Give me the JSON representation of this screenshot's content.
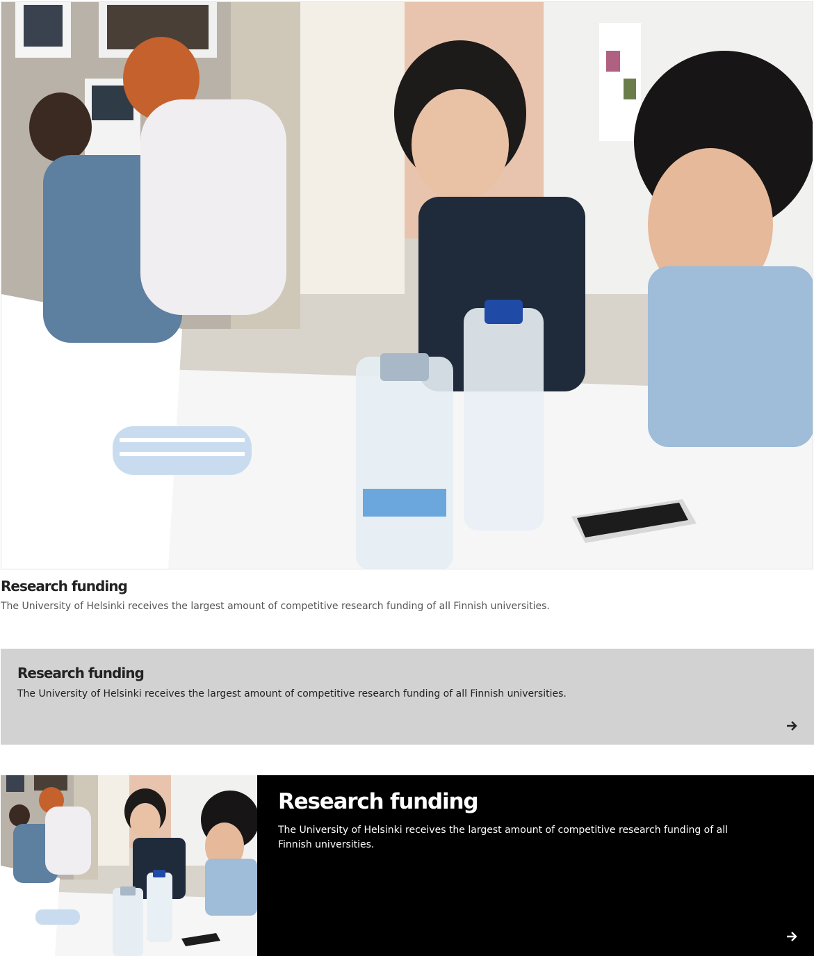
{
  "cards": [
    {
      "title": "Research funding",
      "text": "The University of Helsinki receives the largest amount of competitive research funding of all Finnish universities.",
      "image": "students-working-at-table-photo"
    },
    {
      "title": "Research funding",
      "text": "The University of Helsinki receives the largest amount of competitive research funding of all Finnish universities.",
      "icon": "arrow-right-icon",
      "background": "#d2d2d2"
    },
    {
      "title": "Research funding",
      "text": "The University of Helsinki receives the largest amount of competitive research funding of all Finnish universities.",
      "image": "students-working-at-table-photo",
      "icon": "arrow-right-icon",
      "background": "#000000"
    }
  ]
}
